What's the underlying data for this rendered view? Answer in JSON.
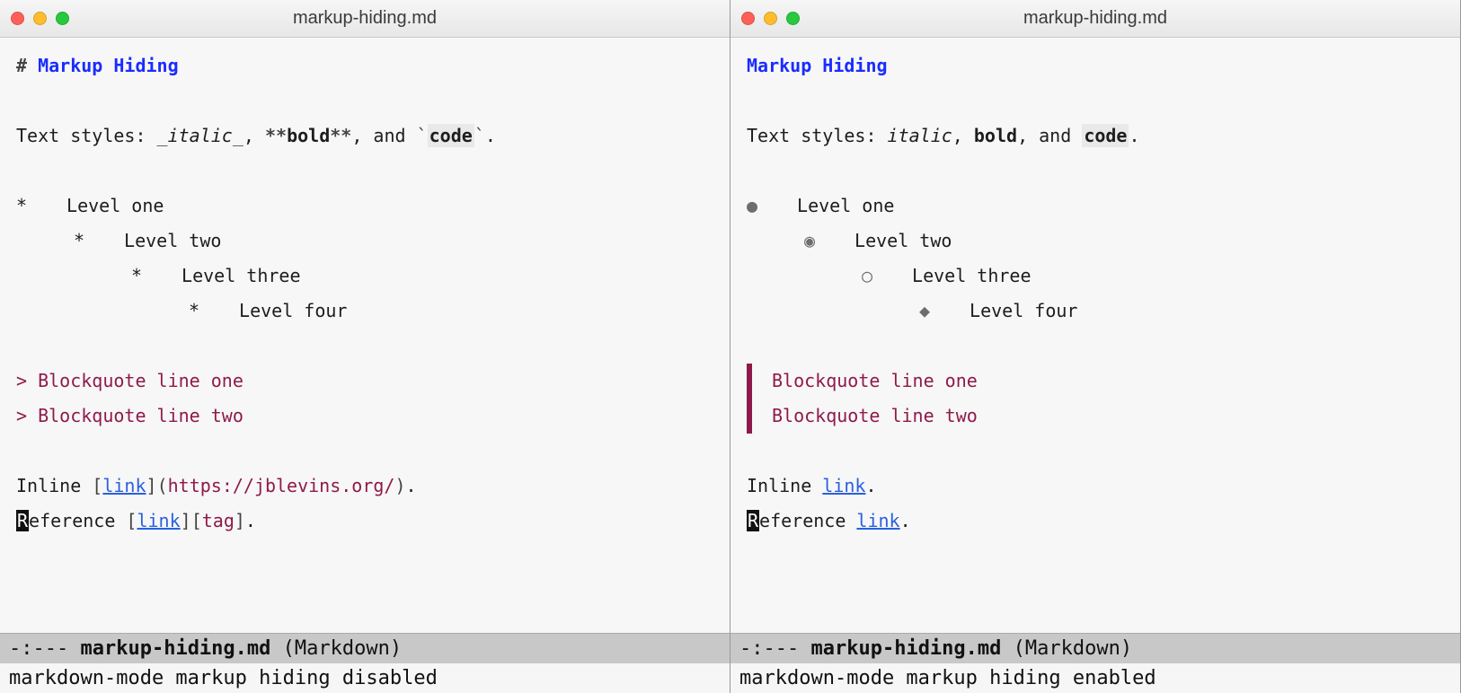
{
  "left": {
    "title": "markup-hiding.md",
    "heading_hash": "#",
    "heading": "Markup Hiding",
    "textstyles_prefix": "Text styles: ",
    "italic_open": "_",
    "italic": "italic",
    "italic_close": "_",
    "sep1": ", ",
    "bold_open": "**",
    "bold": "bold",
    "bold_close": "**",
    "sep2": ", and ",
    "code_open": "`",
    "code": "code",
    "code_close": "`",
    "period": ".",
    "list": {
      "b": "*",
      "l1": "Level one",
      "l2": "Level two",
      "l3": "Level three",
      "l4": "Level four"
    },
    "quote_marker": ">",
    "quote1": "Blockquote line one",
    "quote2": "Blockquote line two",
    "inline_pre": "Inline ",
    "lb": "[",
    "rb": "]",
    "link_text": "link",
    "paren_open": "(",
    "url": "https://jblevins.org/",
    "paren_close": ")",
    "ref_pre_R": "R",
    "ref_pre_rest": "eference ",
    "tag": "tag",
    "modeline_pre": "-:---   ",
    "modeline_buf": "markup-hiding.md",
    "modeline_mode": "   (Markdown)",
    "minibuffer": "markdown-mode markup hiding disabled"
  },
  "right": {
    "title": "markup-hiding.md",
    "heading": "Markup Hiding",
    "textstyles_prefix": "Text styles: ",
    "italic": "italic",
    "sep1": ", ",
    "bold": "bold",
    "sep2": ", and ",
    "code": "code",
    "period": ".",
    "list": {
      "b1": "●",
      "b2": "◉",
      "b3": "○",
      "b4": "◆",
      "l1": "Level one",
      "l2": "Level two",
      "l3": "Level three",
      "l4": "Level four"
    },
    "quote1": "Blockquote line one",
    "quote2": "Blockquote line two",
    "inline_pre": "Inline ",
    "link_text": "link",
    "period2": ".",
    "ref_pre_R": "R",
    "ref_pre_rest": "eference ",
    "modeline_pre": "-:---   ",
    "modeline_buf": "markup-hiding.md",
    "modeline_mode": "   (Markdown)",
    "minibuffer": "markdown-mode markup hiding enabled"
  }
}
